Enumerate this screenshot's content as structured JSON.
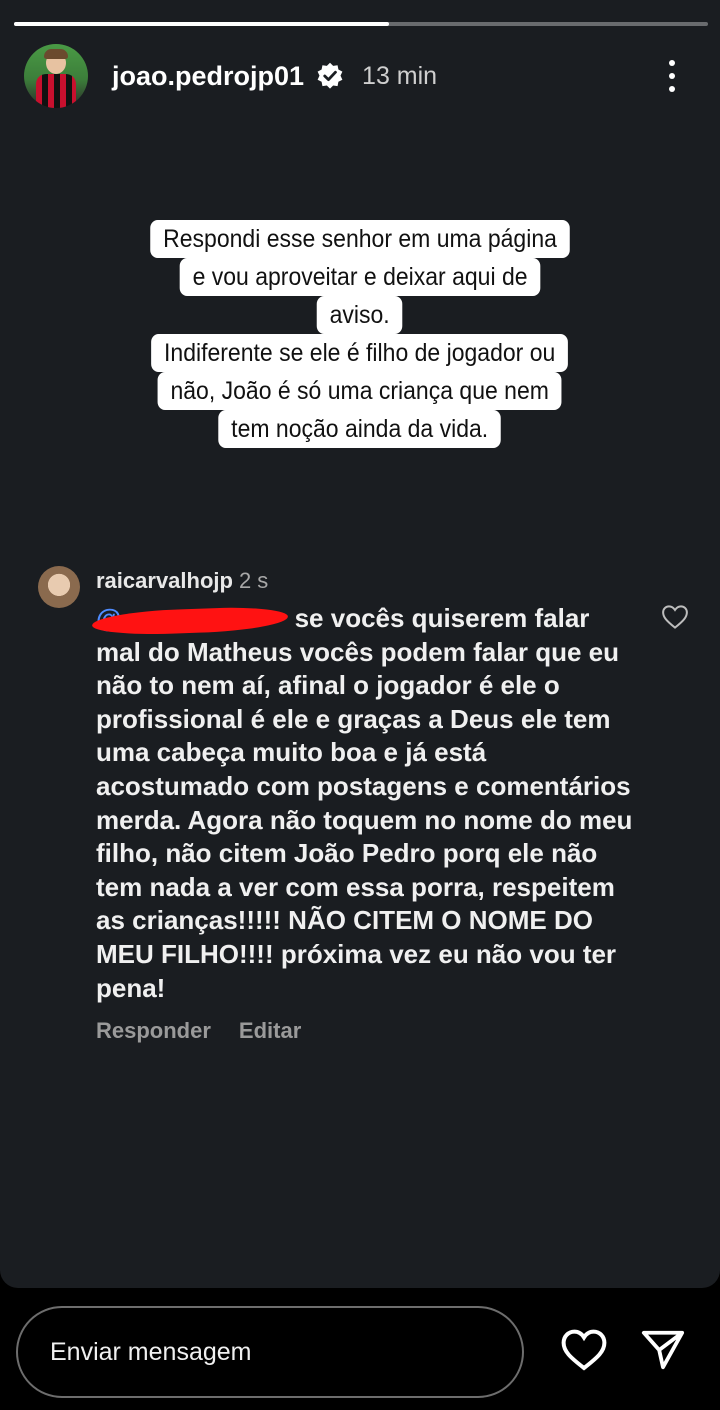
{
  "story": {
    "progress": 0.54,
    "username": "joao.pedrojp01",
    "time_ago": "13 min",
    "caption_lines": [
      "Respondi esse senhor em uma página",
      "e vou aproveitar e deixar aqui de",
      "aviso.",
      "Indiferente se ele é filho de jogador ou",
      "não, João é só uma criança que nem",
      "tem noção ainda da vida."
    ]
  },
  "comment": {
    "username": "raicarvalhojp",
    "age": "2 s",
    "mention": "@",
    "text": "se vocês quiserem falar mal do Matheus vocês podem falar que eu não to nem aí, afinal o jogador é ele o profissional é ele e graças a Deus ele tem uma cabeça muito boa e já está acostumado com postagens e comentários merda. Agora não toquem no nome do meu filho, não citem João Pedro porq ele não tem nada a ver com essa porra, respeitem as crianças!!!!! NÃO CITEM O NOME DO MEU FILHO!!!! próxima vez eu não vou ter pena!",
    "reply_label": "Responder",
    "edit_label": "Editar"
  },
  "footer": {
    "message_placeholder": "Enviar mensagem"
  },
  "icons": {
    "verified": "verified-badge-icon",
    "more": "more-options-icon",
    "like": "heart-icon",
    "send": "send-icon"
  }
}
